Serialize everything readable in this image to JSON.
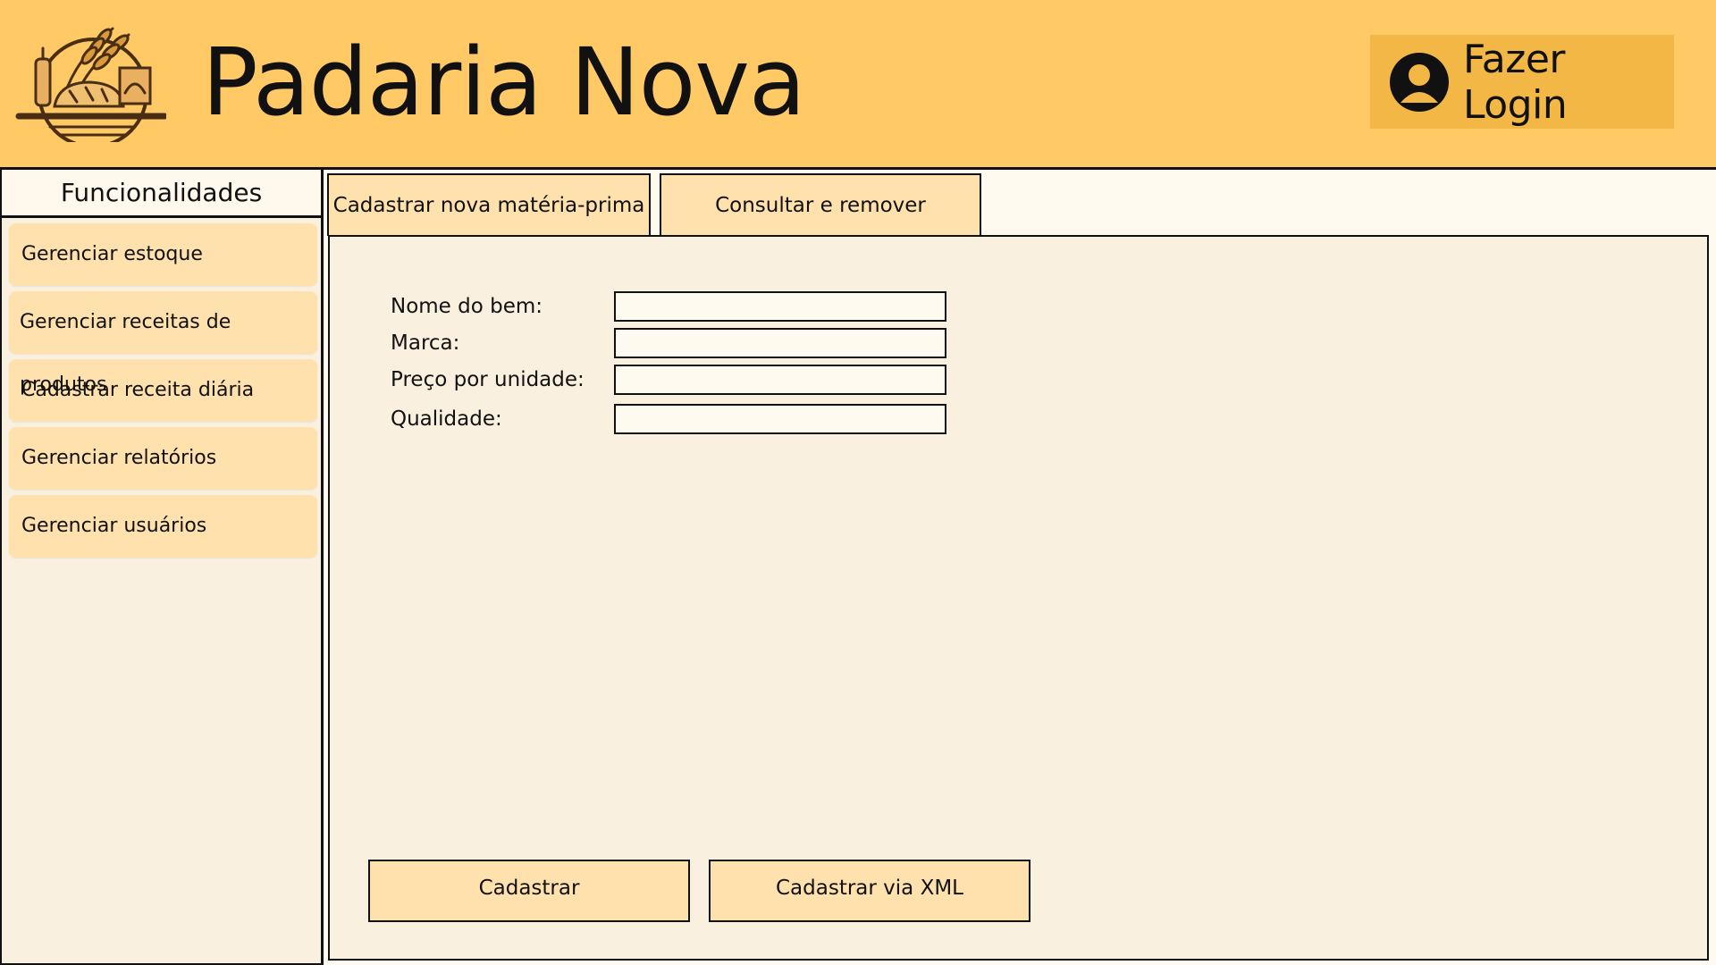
{
  "header": {
    "title": "Padaria Nova",
    "login_label": "Fazer Login",
    "background": "#ffc966",
    "login_background": "#f2b744"
  },
  "icons": {
    "logo": "bakery-logo-icon",
    "user": "user-avatar-icon"
  },
  "sidebar": {
    "title": "Funcionalidades",
    "items": [
      {
        "label": "Gerenciar estoque"
      },
      {
        "label": "Gerenciar receitas de produtos"
      },
      {
        "label": "Cadastrar receita diária"
      },
      {
        "label": "Gerenciar relatórios"
      },
      {
        "label": "Gerenciar usuários"
      }
    ]
  },
  "tabs": [
    {
      "label": "Cadastrar nova matéria-prima"
    },
    {
      "label": "Consultar e remover"
    }
  ],
  "form": {
    "fields": [
      {
        "label": "Nome do bem:",
        "value": ""
      },
      {
        "label": "Marca:",
        "value": ""
      },
      {
        "label": "Preço por unidade:",
        "value": ""
      },
      {
        "label": "Qualidade:",
        "value": ""
      }
    ]
  },
  "actions": {
    "submit_label": "Cadastrar",
    "xml_label": "Cadastrar via XML"
  },
  "colors": {
    "accent": "#ffe1ad",
    "panel": "#faf0e0",
    "border": "#111111"
  }
}
